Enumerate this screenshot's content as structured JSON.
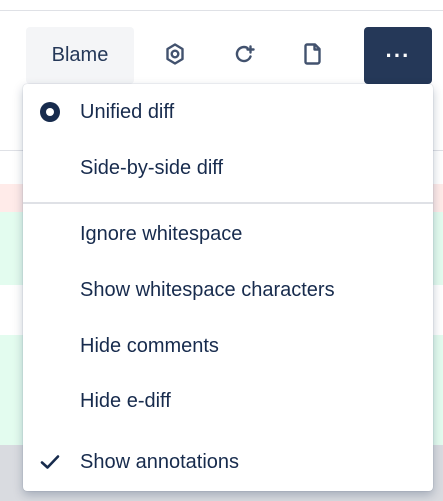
{
  "toolbar": {
    "blame_label": "Blame",
    "settings_icon": "settings-icon",
    "refresh_icon": "refresh-icon",
    "file_icon": "file-icon",
    "more_label": "···"
  },
  "menu": {
    "view_items": [
      {
        "label": "Unified diff",
        "selected": true
      },
      {
        "label": "Side-by-side diff",
        "selected": false
      }
    ],
    "option_items": [
      {
        "label": "Ignore whitespace",
        "checked": false
      },
      {
        "label": "Show whitespace characters",
        "checked": false
      },
      {
        "label": "Hide comments",
        "checked": false
      },
      {
        "label": "Hide e-diff",
        "checked": false
      },
      {
        "label": "Show annotations",
        "checked": true
      }
    ]
  },
  "colors": {
    "primary_dark": "#253858",
    "text": "#172b4d",
    "diff_removed": "#ffebe9",
    "diff_added": "#e3fcef"
  }
}
